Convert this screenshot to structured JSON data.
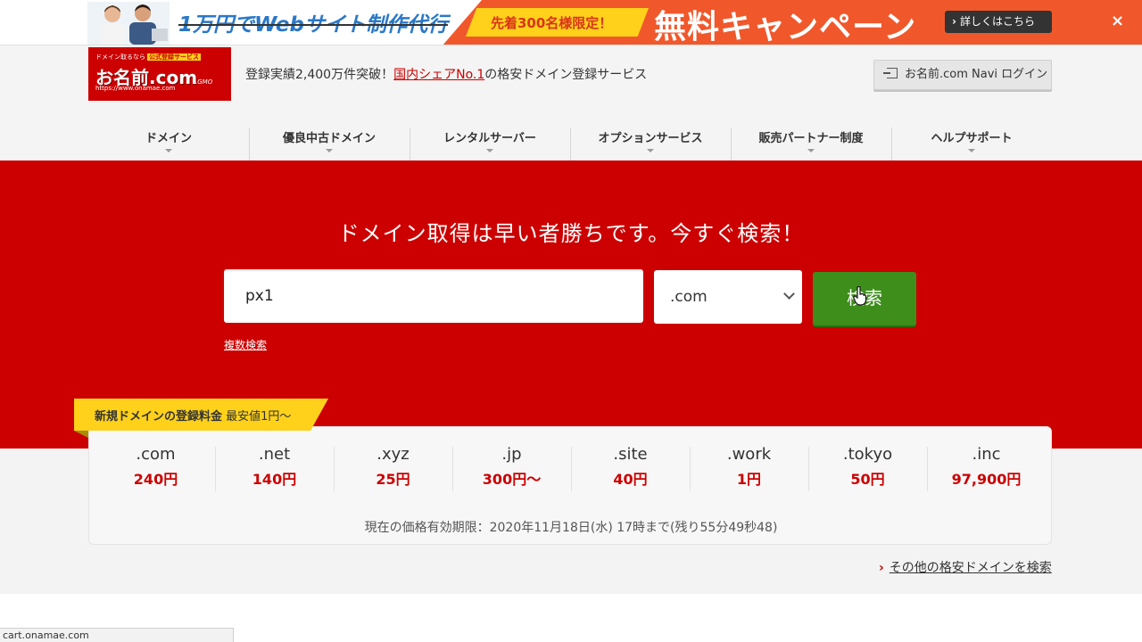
{
  "banner": {
    "old_price_text": "1万円でWebサイト制作代行",
    "limited_text": "先着300名様限定！",
    "campaign_text": "無料キャンペーン",
    "detail_button": "詳しくはこちら",
    "close_label": "×"
  },
  "header": {
    "logo": {
      "top_text": "ドメイン取るなら",
      "badge_text": "公式登録サービス",
      "brand": "お名前.com",
      "url_text": "https://www.onamae.com",
      "gmo_text": ".GMO"
    },
    "tagline_prefix": "登録実績2,400万件突破！",
    "tagline_link": "国内シェアNo.1",
    "tagline_suffix": "の格安ドメイン登録サービス",
    "login_button": "お名前.com Navi ログイン"
  },
  "nav": {
    "items": [
      {
        "label": "ドメイン"
      },
      {
        "label": "優良中古ドメイン"
      },
      {
        "label": "レンタルサーバー"
      },
      {
        "label": "オプションサービス"
      },
      {
        "label": "販売パートナー制度"
      },
      {
        "label": "ヘルプサポート"
      }
    ]
  },
  "hero": {
    "title": "ドメイン取得は早い者勝ちです。今すぐ検索！",
    "search_value": "px1",
    "tld_selected": ".com",
    "search_button": "検索",
    "multi_search_link": "複数検索"
  },
  "prices": {
    "tag_bold": "新規ドメインの登録料金",
    "tag_rest": " 最安値1円～",
    "items": [
      {
        "tld": ".com",
        "price": "240円"
      },
      {
        "tld": ".net",
        "price": "140円"
      },
      {
        "tld": ".xyz",
        "price": "25円"
      },
      {
        "tld": ".jp",
        "price": "300円～"
      },
      {
        "tld": ".site",
        "price": "40円"
      },
      {
        "tld": ".work",
        "price": "1円"
      },
      {
        "tld": ".tokyo",
        "price": "50円"
      },
      {
        "tld": ".inc",
        "price": "97,900円"
      }
    ],
    "validity": "現在の価格有効期限：2020年11月18日(水) 17時まで(残り55分49秒48)"
  },
  "more_link": "その他の格安ドメインを検索",
  "status_bar": {
    "url": "cart.onamae.com"
  },
  "colors": {
    "brand_red": "#cc0000",
    "banner_orange": "#f0582c",
    "accent_yellow": "#ffd11a",
    "search_green": "#3e8e1c"
  }
}
